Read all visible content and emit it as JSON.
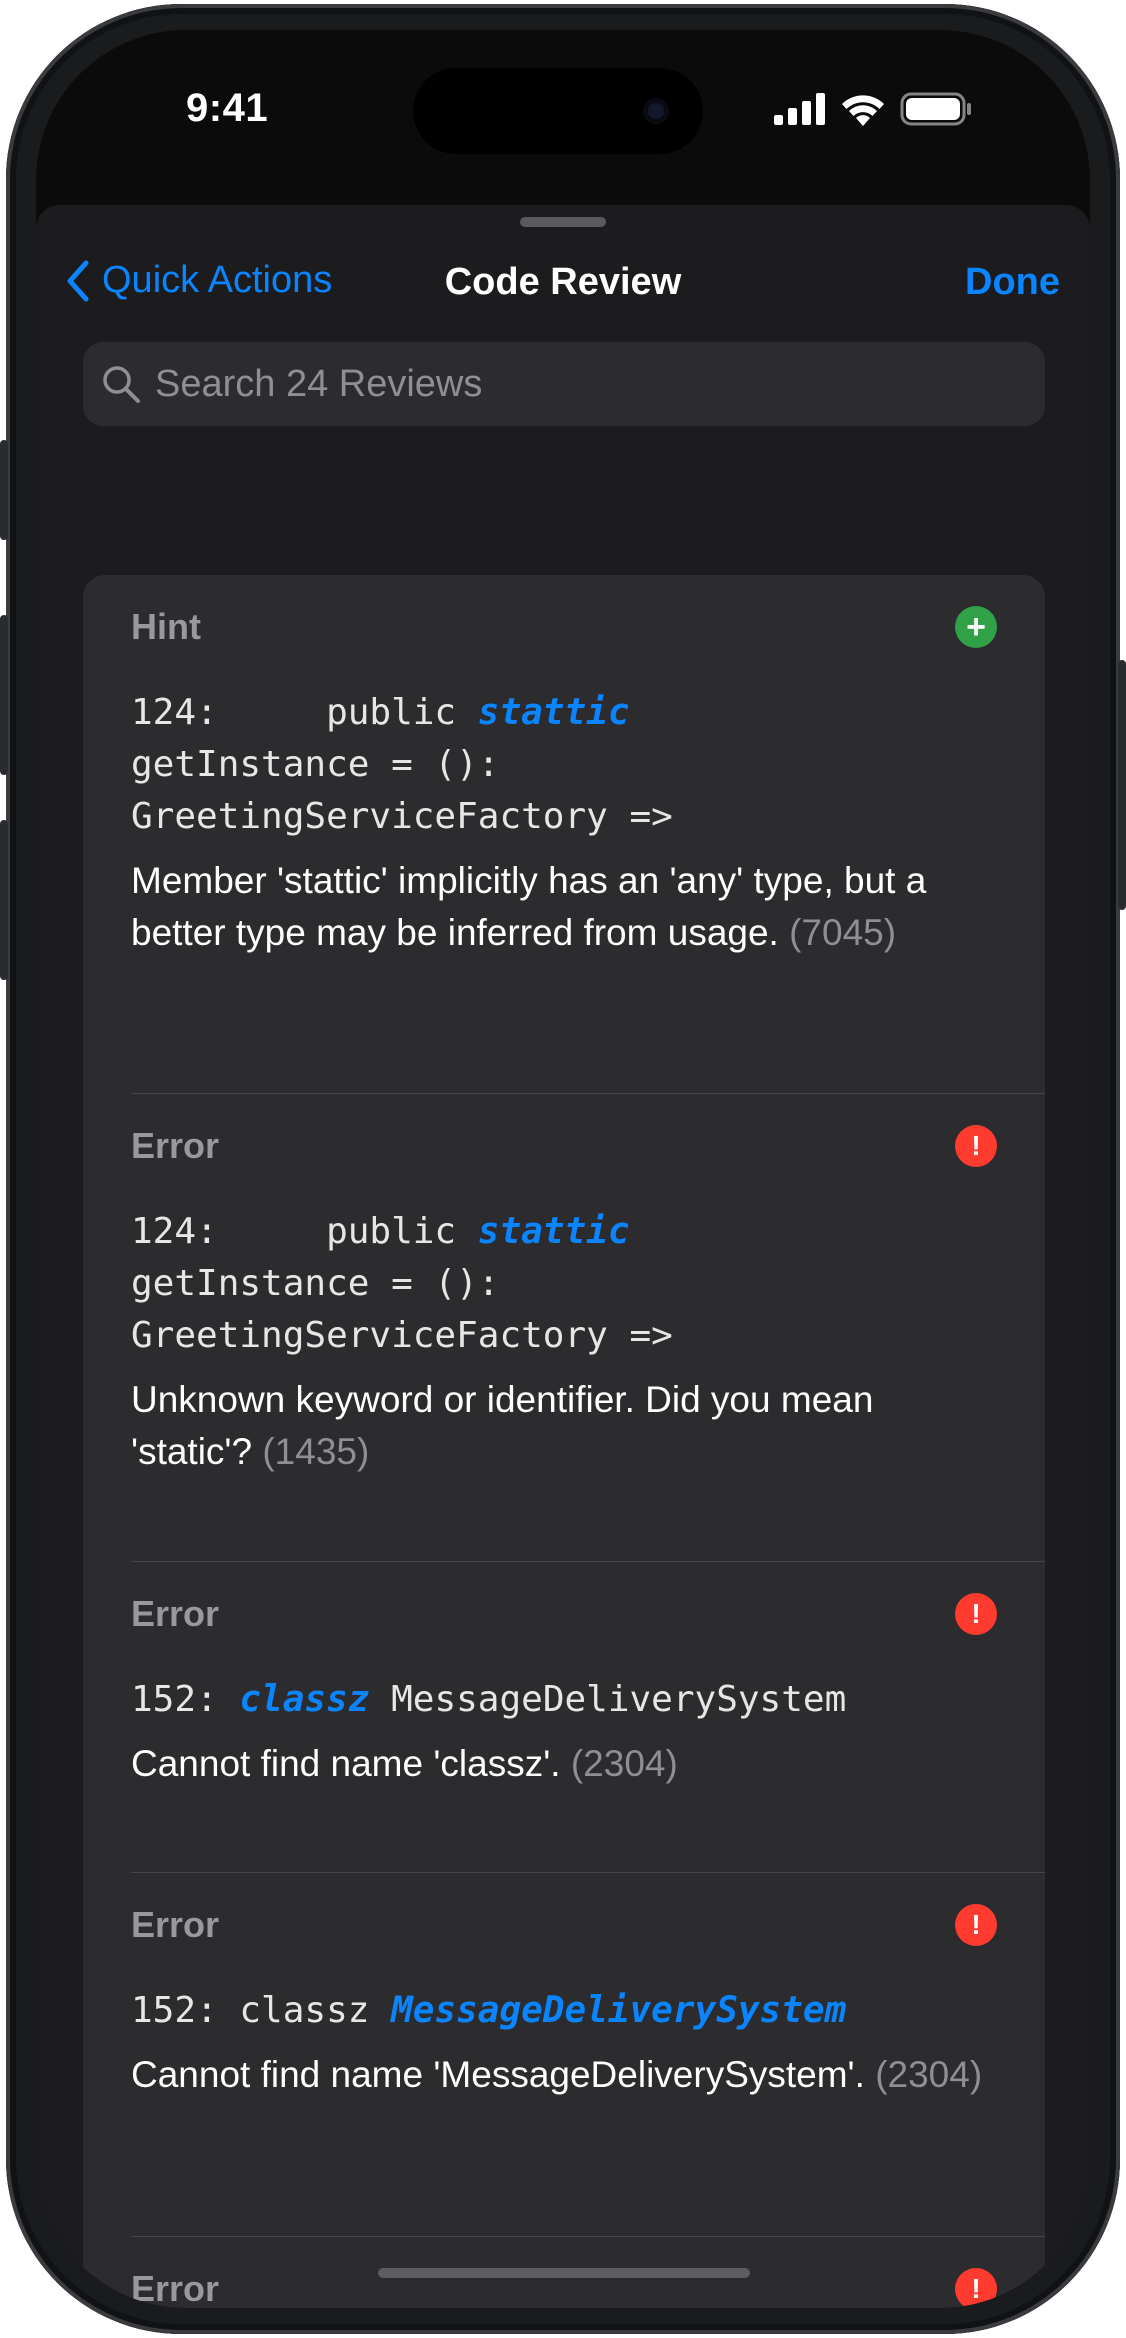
{
  "status_bar": {
    "time": "9:41"
  },
  "nav": {
    "back_label": "Quick Actions",
    "title": "Code Review",
    "done_label": "Done"
  },
  "search": {
    "placeholder": "Search 24 Reviews"
  },
  "reviews": [
    {
      "type": "Hint",
      "badge_icon": "plus-circle-icon",
      "code_prefix": "124:     public ",
      "code_highlight": "stattic",
      "code_suffix": "\ngetInstance = ():\nGreetingServiceFactory =>",
      "message": "Member 'stattic' implicitly has an 'any' type, but a better type may be inferred from usage.",
      "code_number": "(7045)"
    },
    {
      "type": "Error",
      "badge_icon": "exclamation-circle-icon",
      "code_prefix": "124:     public ",
      "code_highlight": "stattic",
      "code_suffix": "\ngetInstance = ():\nGreetingServiceFactory =>",
      "message": "Unknown keyword or identifier. Did you mean 'static'?",
      "code_number": "(1435)"
    },
    {
      "type": "Error",
      "badge_icon": "exclamation-circle-icon",
      "code_prefix": "152: ",
      "code_highlight": "classz",
      "code_suffix": " MessageDeliverySystem",
      "message": "Cannot find name 'classz'.",
      "code_number": "(2304)"
    },
    {
      "type": "Error",
      "badge_icon": "exclamation-circle-icon",
      "code_prefix": "152: classz ",
      "code_highlight": "MessageDeliverySystem",
      "code_suffix": "",
      "message": "Cannot find name 'MessageDeliverySystem'.",
      "code_number": "(2304)"
    },
    {
      "type": "Error",
      "badge_icon": "exclamation-circle-icon"
    }
  ],
  "colors": {
    "accent": "#0a84ff",
    "hint": "#30a147",
    "error": "#ff3b30"
  }
}
